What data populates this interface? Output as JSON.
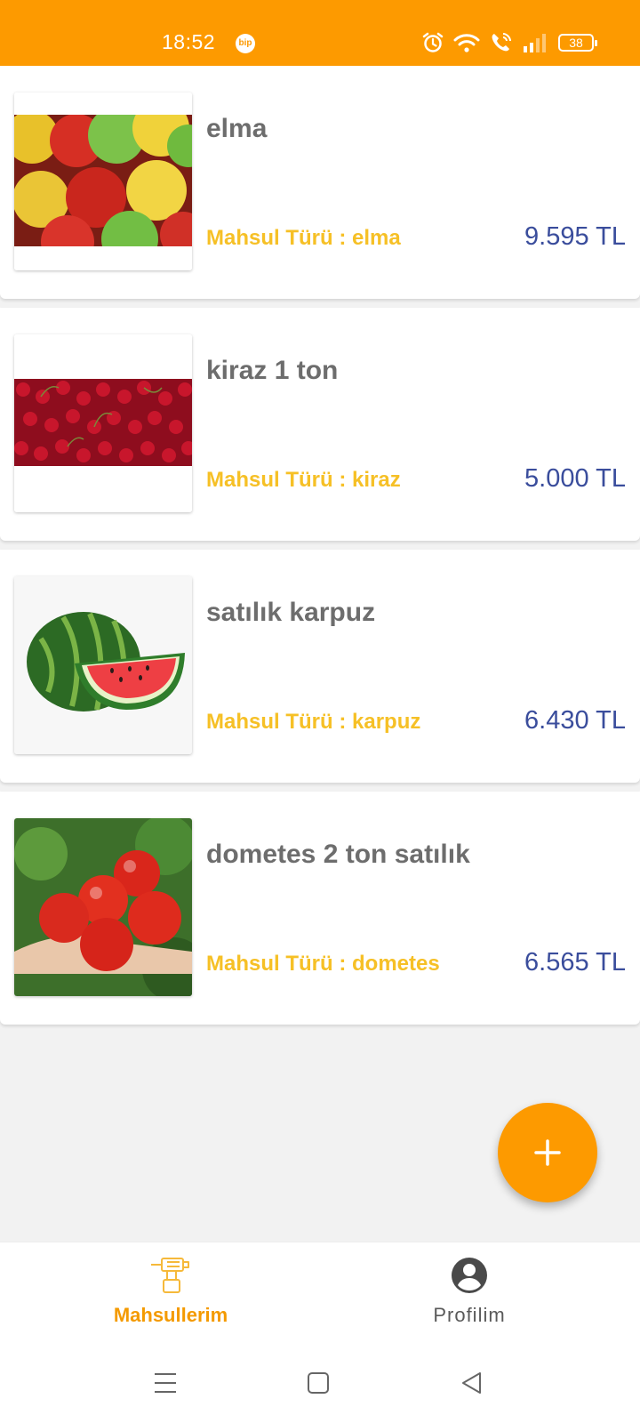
{
  "status_bar": {
    "time": "18:52",
    "bip_label": "bip",
    "battery": "38"
  },
  "products": [
    {
      "title": "elma",
      "type_label": "Mahsul Türü : elma",
      "price": "9.595 TL",
      "image": "apples"
    },
    {
      "title": "kiraz 1 ton",
      "type_label": "Mahsul Türü : kiraz",
      "price": "5.000 TL",
      "image": "cherries"
    },
    {
      "title": "satılık karpuz",
      "type_label": "Mahsul Türü : karpuz",
      "price": "6.430 TL",
      "image": "watermelon"
    },
    {
      "title": "dometes 2 ton satılık",
      "type_label": "Mahsul Türü : dometes",
      "price": "6.565 TL",
      "image": "tomatoes"
    }
  ],
  "fab": {
    "icon": "plus-icon"
  },
  "bottom_nav": {
    "items": [
      {
        "label": "Mahsullerim",
        "icon": "drill-icon",
        "active": true
      },
      {
        "label": "Profilim",
        "icon": "account-circle-icon",
        "active": false
      }
    ]
  },
  "system_nav": {
    "icons": [
      "menu-icon",
      "home-square-icon",
      "back-triangle-icon"
    ]
  },
  "colors": {
    "accent": "#fd9a00",
    "price": "#3a4d9c",
    "type": "#f6c026",
    "title": "#6d6d6d"
  }
}
